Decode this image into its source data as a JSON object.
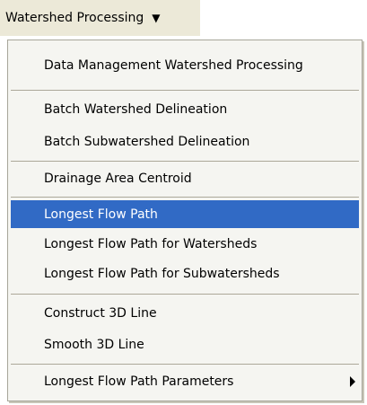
{
  "menubar": {
    "title": "Watershed Processing",
    "arrow": "▼"
  },
  "menu": {
    "items": [
      {
        "label": "Data Management Watershed Processing"
      },
      {
        "label": "Batch Watershed Delineation"
      },
      {
        "label": "Batch Subwatershed Delineation"
      },
      {
        "label": "Drainage Area Centroid"
      },
      {
        "label": "Longest Flow Path",
        "highlighted": true
      },
      {
        "label": "Longest Flow Path for Watersheds"
      },
      {
        "label": "Longest Flow Path for Subwatersheds"
      },
      {
        "label": "Construct 3D Line"
      },
      {
        "label": "Smooth 3D Line"
      },
      {
        "label": "Longest Flow Path Parameters",
        "has_submenu": true
      }
    ]
  },
  "colors": {
    "highlight": "#316ac5",
    "menubar_bg": "#ece9d8",
    "menu_bg": "#f5f5f1"
  }
}
